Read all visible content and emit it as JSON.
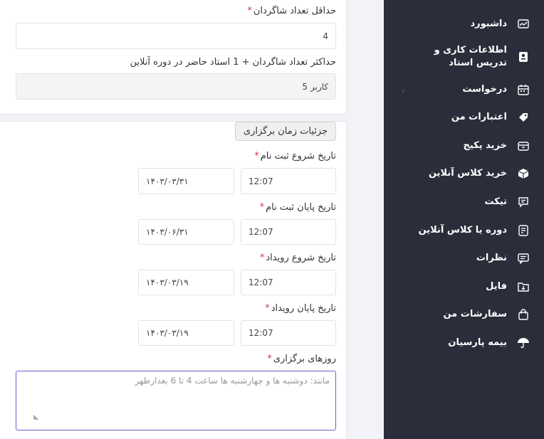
{
  "form": {
    "min_students_label": "حداقل تعداد شاگردان",
    "min_students_value": "4",
    "max_students_label": "حداکثر تعداد شاگردان + 1 استاد حاضر در دوره آنلاین",
    "max_students_value": "5 کاربر",
    "schedule_section_label": "جزئیات زمان برگزاری",
    "reg_start_label": "تاریخ شروع ثبت نام",
    "reg_start_time": "12:07",
    "reg_start_date": "۱۴۰۳/۰۳/۳۱",
    "reg_end_label": "تاریخ پایان ثبت نام",
    "reg_end_time": "12:07",
    "reg_end_date": "۱۴۰۳/۰۶/۳۱",
    "event_start_label": "تاریخ شروع رویداد",
    "event_start_time": "12:07",
    "event_start_date": "۱۴۰۳/۰۳/۱۹",
    "event_end_label": "تاریخ پایان رویداد",
    "event_end_time": "12:07",
    "event_end_date": "۱۴۰۳/۰۳/۱۹",
    "days_label": "روزهای برگزاری",
    "days_placeholder": "مانند: دوشنبه ها و چهارشنبه ها ساعت 4 تا 6 بعدازظهر",
    "required_mark": "*"
  },
  "sidebar": {
    "items": [
      {
        "label": "داشبورد",
        "icon": "dashboard-chart-icon"
      },
      {
        "label": "اطلاعات کاری و تدریس استاد",
        "icon": "teacher-id-icon"
      },
      {
        "label": "درخواست",
        "icon": "request-calendar-icon"
      },
      {
        "label": "اعتبارات من",
        "icon": "credit-tag-icon"
      },
      {
        "label": "خرید پکیج",
        "icon": "package-box-icon"
      },
      {
        "label": "خرید کلاس آنلاین",
        "icon": "online-class-cube-icon"
      },
      {
        "label": "تیکت",
        "icon": "ticket-chat-icon"
      },
      {
        "label": "دوره یا کلاس آنلاین",
        "icon": "course-sheet-icon"
      },
      {
        "label": "نظرات",
        "icon": "comments-icon"
      },
      {
        "label": "فایل",
        "icon": "file-folder-icon"
      },
      {
        "label": "سفارشات من",
        "icon": "shopping-bag-icon"
      },
      {
        "label": "بیمه پارسیان",
        "icon": "umbrella-icon"
      }
    ],
    "chevron": "‹"
  },
  "colors": {
    "sidebar_bg": "#2b2d3a",
    "required": "#e0334b",
    "focus_border": "#6c63c9"
  }
}
